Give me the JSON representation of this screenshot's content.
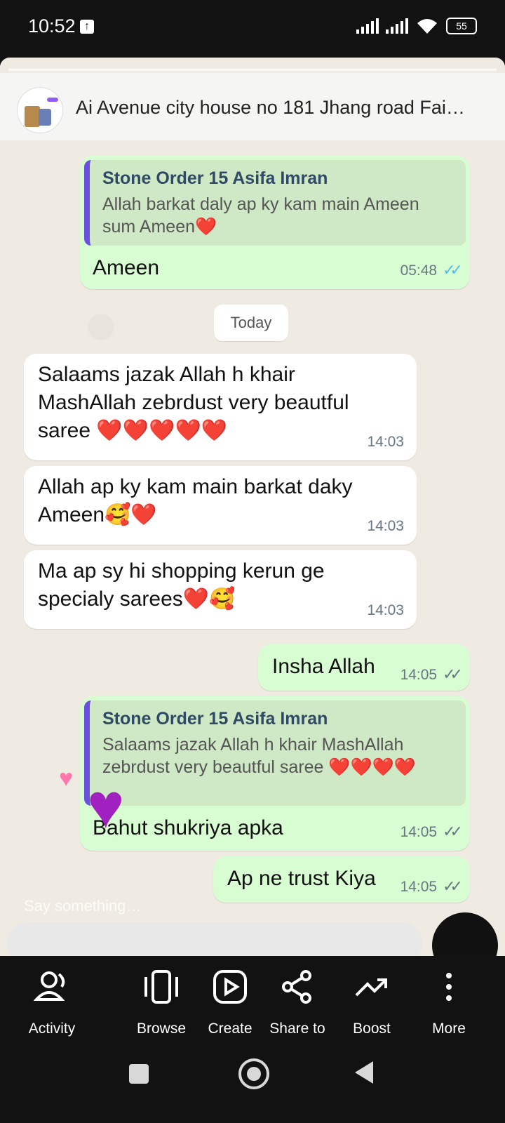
{
  "status_bar": {
    "time": "10:52",
    "battery": "55"
  },
  "story": {
    "title": "Ai Avenue city house no 181 Jhang road Fai…",
    "date_divider": "Today",
    "reaction_placeholder": "Say something…"
  },
  "messages": [
    {
      "direction": "outgoing",
      "quote_author": "Stone Order 15 Asifa Imran",
      "quote_text": "Allah barkat daly ap ky kam main Ameen sum Ameen❤️",
      "text": "Ameen",
      "time": "05:48",
      "status": "read"
    },
    {
      "direction": "incoming",
      "text": "Salaams jazak Allah h khair MashAllah zebrdust  very beautful saree ❤️❤️❤️❤️❤️",
      "time": "14:03"
    },
    {
      "direction": "incoming",
      "text": "Allah ap ky kam main barkat daky Ameen🥰❤️",
      "time": "14:03"
    },
    {
      "direction": "incoming",
      "text": "Ma ap sy hi shopping kerun ge specialy sarees❤️🥰",
      "time": "14:03"
    },
    {
      "direction": "outgoing",
      "text": "Insha Allah",
      "time": "14:05",
      "status": "delivered"
    },
    {
      "direction": "outgoing",
      "quote_author": "Stone Order 15 Asifa Imran",
      "quote_text": "Salaams jazak Allah h khair MashAllah zebrdust  very beautful saree ❤️❤️❤️❤️",
      "text": "Bahut shukriya apka",
      "time": "14:05",
      "status": "delivered"
    },
    {
      "direction": "outgoing",
      "text": "Ap ne trust Kiya",
      "time": "14:05",
      "status": "delivered"
    }
  ],
  "bottom_nav": [
    {
      "label": "Activity",
      "icon": "activity-icon"
    },
    {
      "label": "Browse",
      "icon": "browse-icon"
    },
    {
      "label": "Create",
      "icon": "create-icon"
    },
    {
      "label": "Share to",
      "icon": "share-icon"
    },
    {
      "label": "Boost",
      "icon": "boost-icon"
    },
    {
      "label": "More",
      "icon": "more-icon"
    }
  ],
  "colors": {
    "incoming_bubble": "#ffffff",
    "outgoing_bubble": "#d9fdd3",
    "quote_bar": "#6b4fe0",
    "read_ticks": "#53bdeb"
  }
}
